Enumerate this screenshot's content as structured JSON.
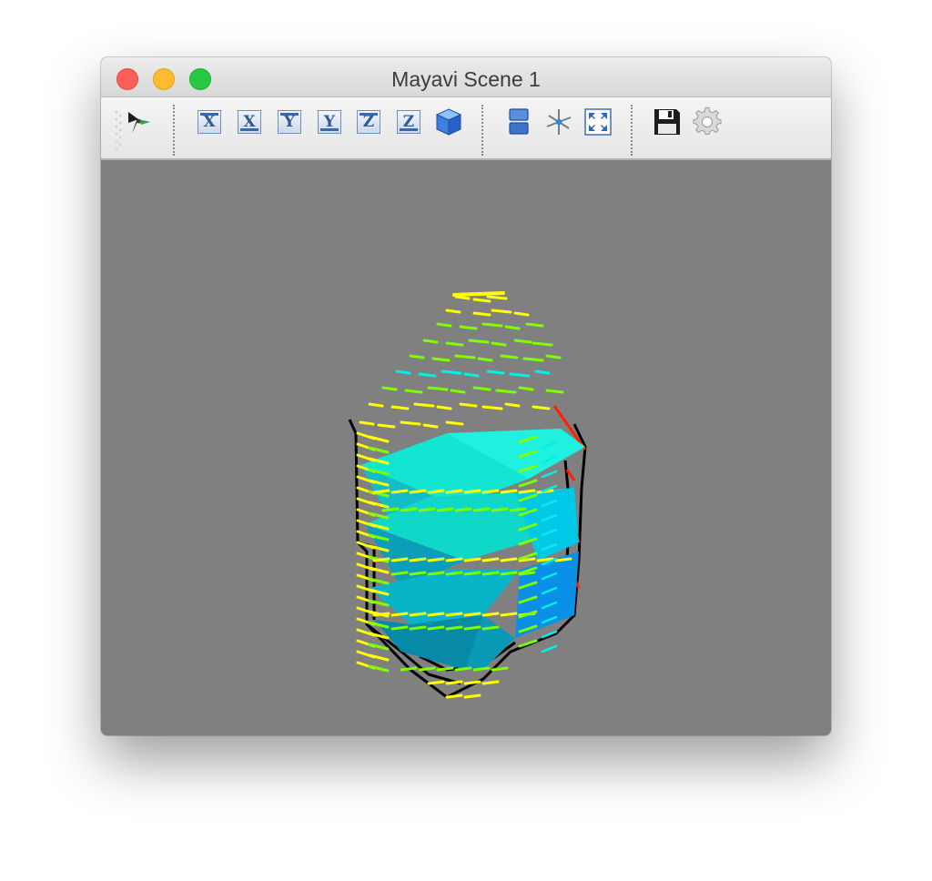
{
  "window": {
    "title": "Mayavi Scene 1"
  },
  "toolbar": {
    "buttons": [
      {
        "icon": "mayavi-engine-icon"
      },
      {
        "label": "X",
        "icon": "view-minus-x-icon"
      },
      {
        "label": "X",
        "icon": "view-plus-x-icon"
      },
      {
        "label": "Y",
        "icon": "view-minus-y-icon"
      },
      {
        "label": "Y",
        "icon": "view-plus-y-icon"
      },
      {
        "label": "Z",
        "icon": "view-minus-z-icon"
      },
      {
        "label": "Z",
        "icon": "view-plus-z-icon"
      },
      {
        "icon": "isometric-cube-icon"
      },
      {
        "icon": "parallel-projection-icon"
      },
      {
        "icon": "axes-indicator-icon"
      },
      {
        "icon": "full-screen-icon"
      },
      {
        "icon": "save-disk-icon"
      },
      {
        "icon": "settings-gear-icon"
      }
    ]
  },
  "scene": {
    "background": "#808080",
    "colors": {
      "yellow": "#ffff00",
      "green": "#7dff00",
      "cyan": "#00f0e6",
      "blue": "#0096f0",
      "outline": "#000000",
      "red": "#ff2000"
    }
  }
}
